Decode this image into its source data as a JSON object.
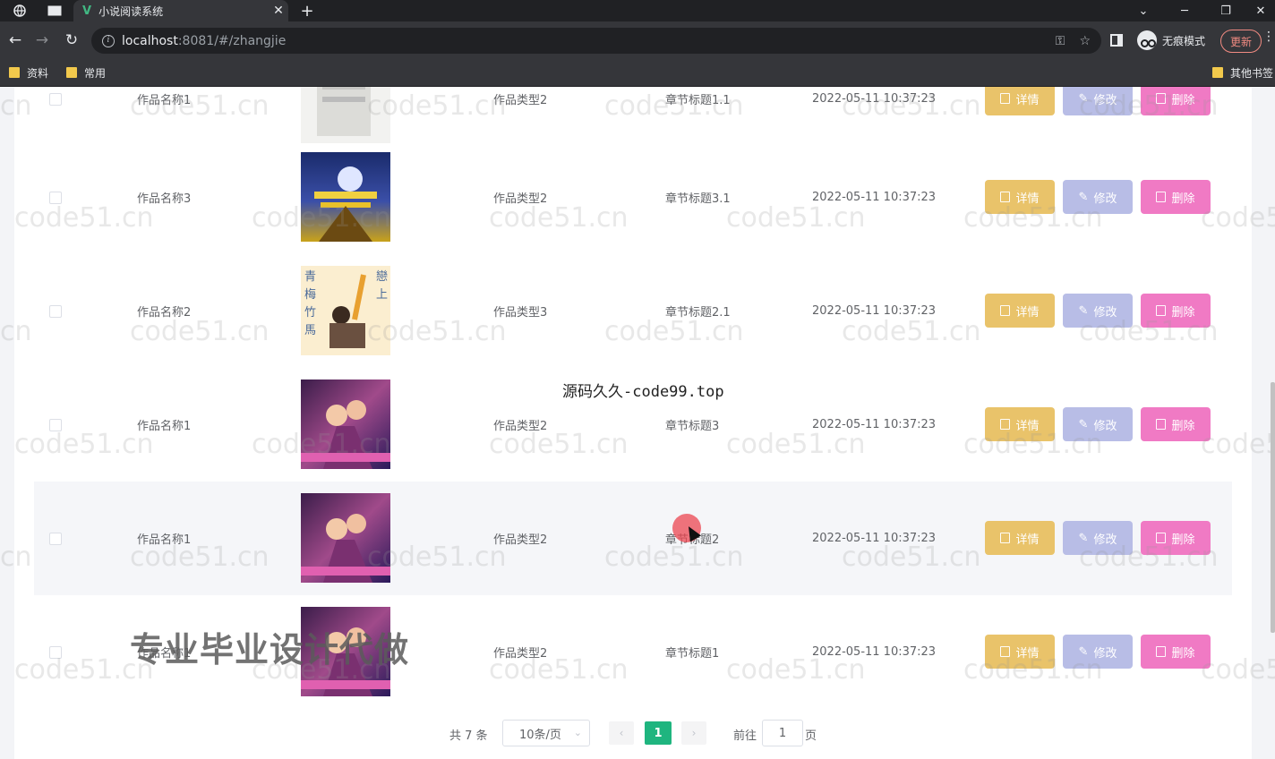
{
  "browser": {
    "tab_title": "小说阅读系统",
    "vue_logo": "V",
    "url_host": "localhost",
    "url_path": ":8081/#/zhangjie",
    "incognito_label": "无痕模式",
    "update_label": "更新",
    "bookmarks": [
      "资料",
      "常用"
    ],
    "other_bookmarks": "其他书签"
  },
  "table": {
    "rows": [
      {
        "name": "作品名称1",
        "type": "作品类型2",
        "chapter": "章节标题1.1",
        "time": "2022-05-11 10:37:23"
      },
      {
        "name": "作品名称3",
        "type": "作品类型2",
        "chapter": "章节标题3.1",
        "time": "2022-05-11 10:37:23"
      },
      {
        "name": "作品名称2",
        "type": "作品类型3",
        "chapter": "章节标题2.1",
        "time": "2022-05-11 10:37:23"
      },
      {
        "name": "作品名称1",
        "type": "作品类型2",
        "chapter": "章节标题3",
        "time": "2022-05-11 10:37:23"
      },
      {
        "name": "作品名称1",
        "type": "作品类型2",
        "chapter": "章节标题2",
        "time": "2022-05-11 10:37:23"
      },
      {
        "name": "作品名称1",
        "type": "作品类型2",
        "chapter": "章节标题1",
        "time": "2022-05-11 10:37:23"
      }
    ],
    "actions": {
      "detail": "详情",
      "edit": "修改",
      "delete": "删除"
    }
  },
  "pagination": {
    "total": "共 7 条",
    "page_size": "10条/页",
    "current_page": "1",
    "goto_label": "前往",
    "goto_value": "1",
    "page_suffix": "页"
  },
  "watermark_text": "code51.cn",
  "overlay_site": "源码久久-code99.top",
  "overlay_ad": "专业毕业设计代做",
  "colors": {
    "detail": "#e9c36a",
    "edit": "#b8bde6",
    "delete": "#f07ac4",
    "active_page": "#1fb57f"
  }
}
